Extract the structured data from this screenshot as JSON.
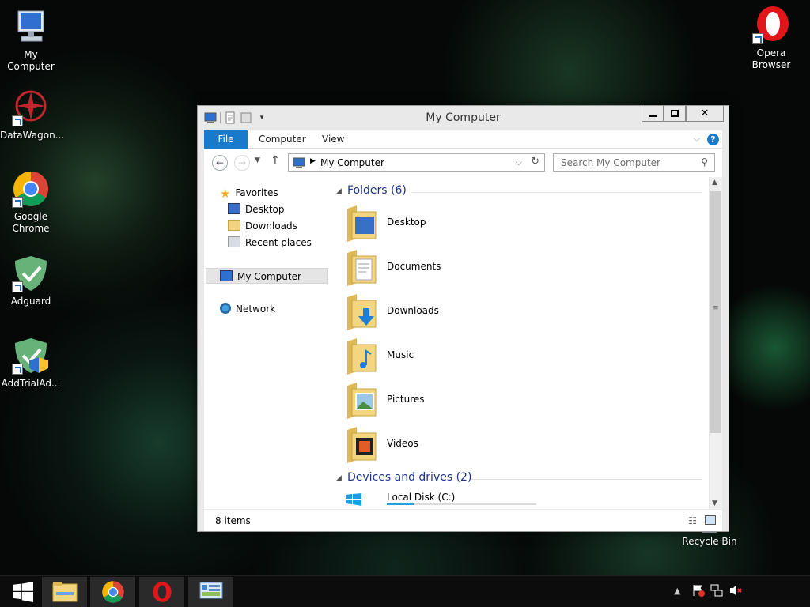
{
  "desktop": {
    "icons": [
      {
        "label": "My Computer",
        "icon": "computer-icon"
      },
      {
        "label": "DataWagon...",
        "icon": "datawagon-icon"
      },
      {
        "label": "Google Chrome",
        "icon": "chrome-icon"
      },
      {
        "label": "Adguard",
        "icon": "adguard-icon"
      },
      {
        "label": "AddTrialAd...",
        "icon": "addtrial-icon"
      },
      {
        "label": "Opera Browser",
        "icon": "opera-icon"
      },
      {
        "label": "Recycle Bin",
        "icon": "recycle-bin-icon"
      }
    ]
  },
  "window": {
    "title": "My Computer",
    "ribbon_tabs": [
      "File",
      "Computer",
      "View"
    ],
    "help_label": "?",
    "address": "My Computer",
    "search_placeholder": "Search My Computer",
    "nav": {
      "favorites": "Favorites",
      "desktop": "Desktop",
      "downloads": "Downloads",
      "recent": "Recent places",
      "computer": "My Computer",
      "network": "Network"
    },
    "folders_header": "Folders (6)",
    "folders": [
      "Desktop",
      "Documents",
      "Downloads",
      "Music",
      "Pictures",
      "Videos"
    ],
    "devices_header": "Devices and drives (2)",
    "devices": [
      {
        "name": "Local Disk (C:)",
        "used_fraction": 0.18
      }
    ],
    "status": "8 items"
  },
  "colors": {
    "accent": "#1979ca",
    "header_text": "#1e3287"
  }
}
